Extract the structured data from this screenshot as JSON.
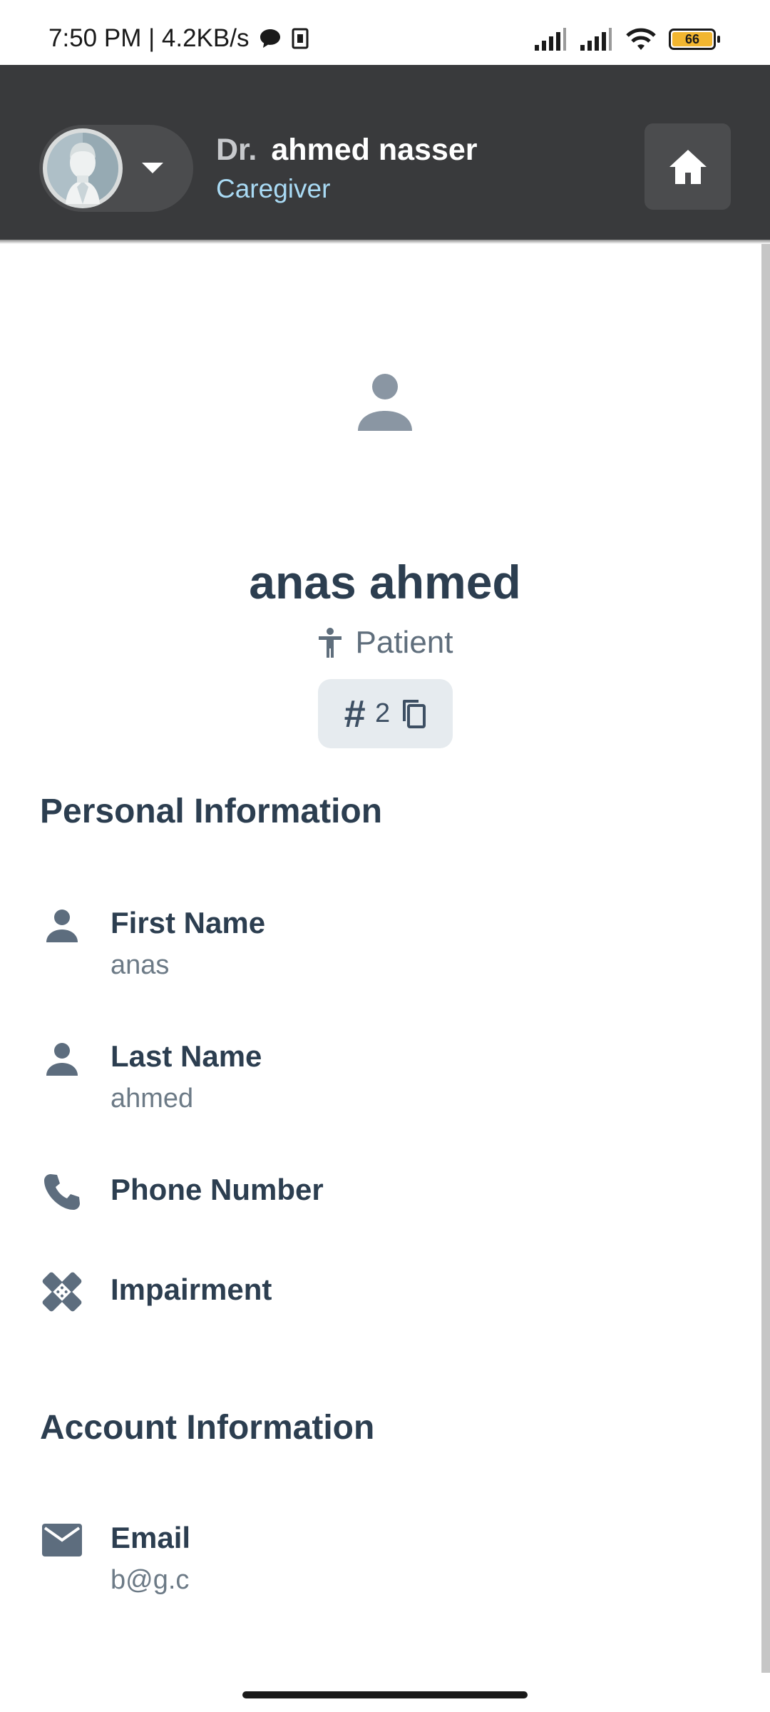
{
  "status_bar": {
    "time": "7:50 PM | 4.2KB/s",
    "battery_level": "66"
  },
  "header": {
    "doctor_prefix": "Dr.",
    "doctor_name": "ahmed nasser",
    "role": "Caregiver",
    "home_icon": "home-icon"
  },
  "profile": {
    "name": "anas ahmed",
    "role": "Patient",
    "id": "2"
  },
  "personal_info": {
    "title": "Personal Information",
    "first_name_label": "First Name",
    "first_name_value": "anas",
    "last_name_label": "Last Name",
    "last_name_value": "ahmed",
    "phone_label": "Phone Number",
    "impairment_label": "Impairment"
  },
  "account_info": {
    "title": "Account Information",
    "email_label": "Email",
    "email_value": "b@g.c"
  },
  "colors": {
    "appbar": "#393a3c",
    "role_accent": "#a9daf4",
    "text_dark": "#2c3e50",
    "text_muted": "#6c7a86",
    "icon": "#5d6d7e"
  }
}
